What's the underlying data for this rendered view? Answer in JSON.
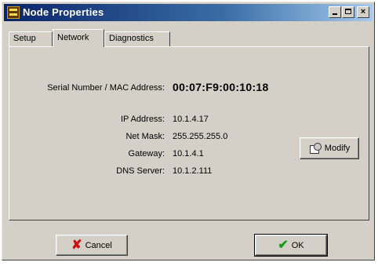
{
  "window": {
    "title": "Node Properties",
    "icon": "dmx-node-icon",
    "controls": {
      "minimize": "_",
      "maximize": "□",
      "close": "×"
    }
  },
  "tabs": [
    {
      "label": "Setup",
      "active": false
    },
    {
      "label": "Network",
      "active": true
    },
    {
      "label": "Diagnostics",
      "active": false
    }
  ],
  "network": {
    "mac_label": "Serial Number / MAC Address:",
    "mac_value": "00:07:F9:00:10:18",
    "fields": [
      {
        "label": "IP Address:",
        "value": "10.1.4.17"
      },
      {
        "label": "Net Mask:",
        "value": "255.255.255.0"
      },
      {
        "label": "Gateway:",
        "value": "10.1.4.1"
      },
      {
        "label": "DNS Server:",
        "value": "10.1.2.111"
      }
    ],
    "modify_label": "Modify"
  },
  "footer": {
    "cancel_label": "Cancel",
    "ok_label": "OK"
  },
  "colors": {
    "face": "#d4d0c8",
    "title_start": "#0a246a",
    "title_end": "#a6caf0",
    "cancel_icon": "#d01010",
    "ok_icon": "#1a9a1a"
  }
}
